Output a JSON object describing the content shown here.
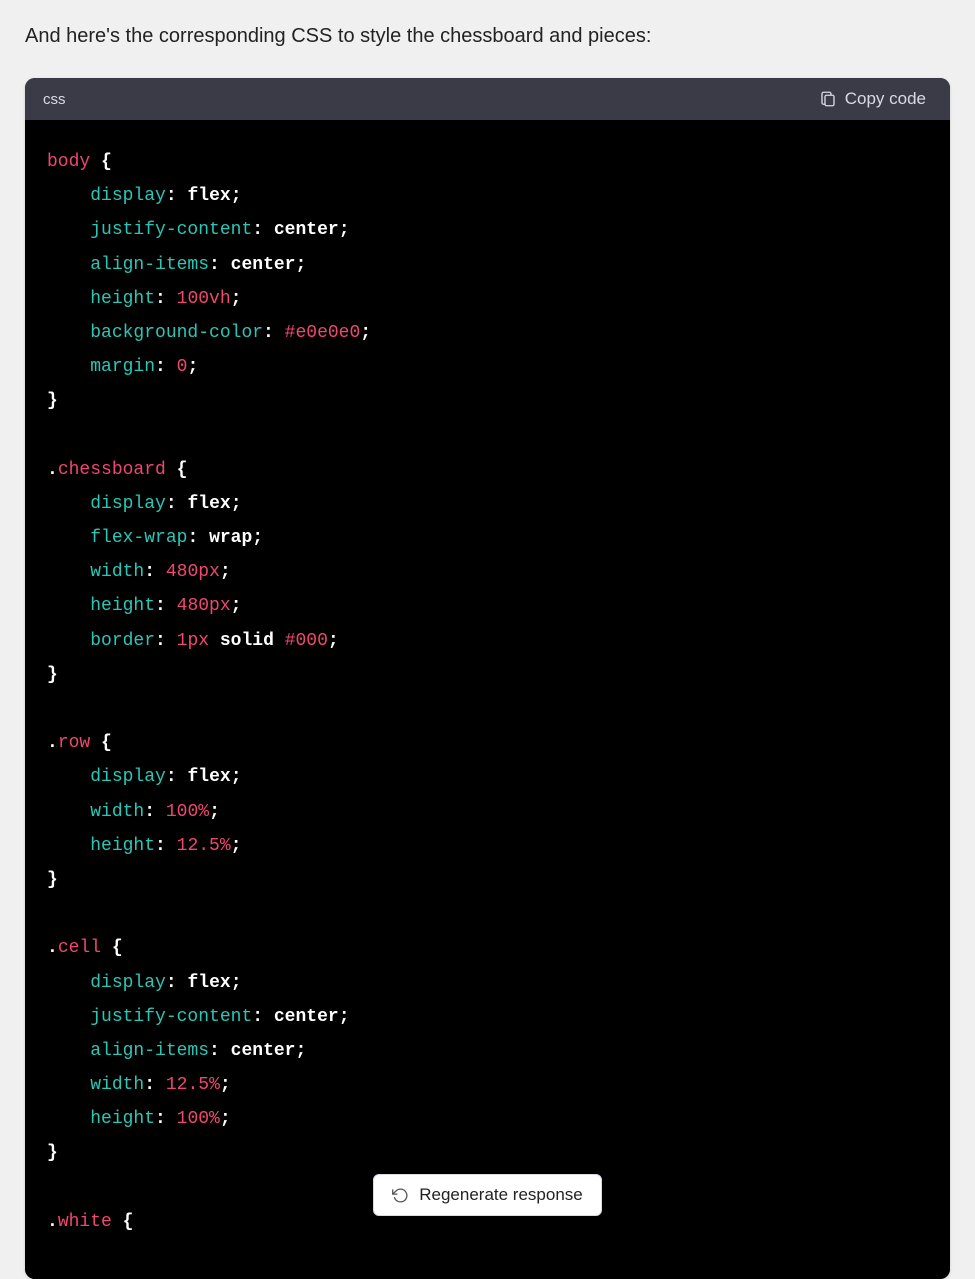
{
  "intro": "And here's the corresponding CSS to style the chessboard and pieces:",
  "code_block": {
    "language": "css",
    "copy_label": "Copy code",
    "rules": [
      {
        "selector": "body",
        "declarations": [
          {
            "prop": "display",
            "value": "flex",
            "value_kind": "kw"
          },
          {
            "prop": "justify-content",
            "value": "center",
            "value_kind": "kw"
          },
          {
            "prop": "align-items",
            "value": "center",
            "value_kind": "kw"
          },
          {
            "prop": "height",
            "value": "100vh",
            "value_kind": "num"
          },
          {
            "prop": "background-color",
            "value": "#e0e0e0",
            "value_kind": "num"
          },
          {
            "prop": "margin",
            "value": "0",
            "value_kind": "num"
          }
        ]
      },
      {
        "selector": ".chessboard",
        "declarations": [
          {
            "prop": "display",
            "value": "flex",
            "value_kind": "kw"
          },
          {
            "prop": "flex-wrap",
            "value": "wrap",
            "value_kind": "kw"
          },
          {
            "prop": "width",
            "value": "480px",
            "value_kind": "num"
          },
          {
            "prop": "height",
            "value": "480px",
            "value_kind": "num"
          },
          {
            "prop": "border",
            "value": "1px solid #000",
            "value_kind": "mixed"
          }
        ]
      },
      {
        "selector": ".row",
        "declarations": [
          {
            "prop": "display",
            "value": "flex",
            "value_kind": "kw"
          },
          {
            "prop": "width",
            "value": "100%",
            "value_kind": "num"
          },
          {
            "prop": "height",
            "value": "12.5%",
            "value_kind": "num"
          }
        ]
      },
      {
        "selector": ".cell",
        "declarations": [
          {
            "prop": "display",
            "value": "flex",
            "value_kind": "kw"
          },
          {
            "prop": "justify-content",
            "value": "center",
            "value_kind": "kw"
          },
          {
            "prop": "align-items",
            "value": "center",
            "value_kind": "kw"
          },
          {
            "prop": "width",
            "value": "12.5%",
            "value_kind": "num"
          },
          {
            "prop": "height",
            "value": "100%",
            "value_kind": "num"
          }
        ]
      },
      {
        "selector": ".white",
        "open_only": true,
        "declarations": []
      }
    ]
  },
  "footer": {
    "regenerate_label": "Regenerate response"
  },
  "colors": {
    "header_bg": "#3b3b48",
    "selector_pink": "#ef476f",
    "property_teal": "#2ac7b7"
  },
  "icons": {
    "clipboard": "clipboard-icon",
    "regenerate": "regenerate-icon"
  }
}
